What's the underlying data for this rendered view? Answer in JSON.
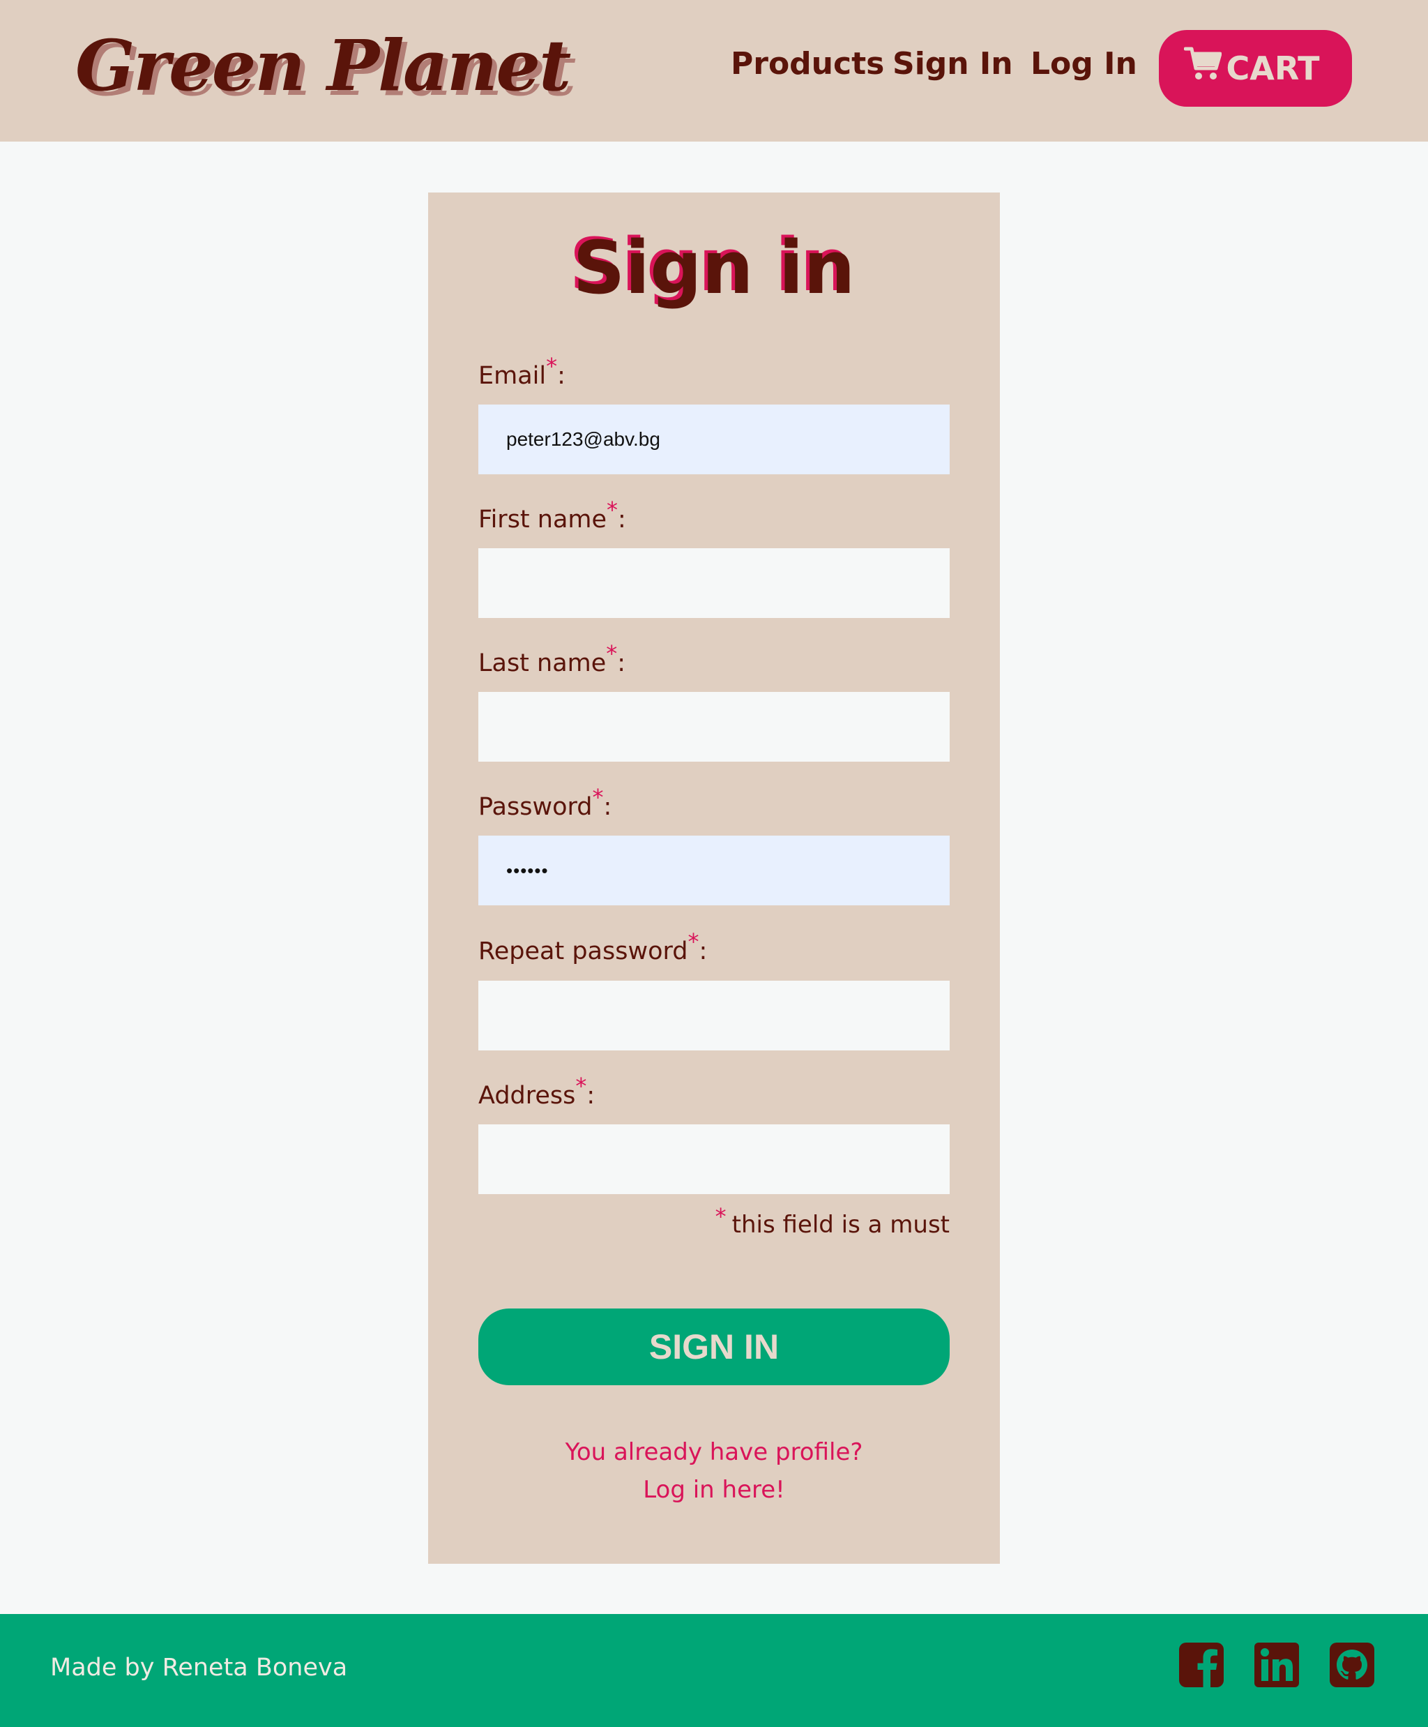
{
  "header": {
    "logo": "Green Planet",
    "nav": {
      "products": "Products",
      "sign_in": "Sign In",
      "log_in": "Log In"
    },
    "cart_label": "CART"
  },
  "form": {
    "title": "Sign in",
    "required_marker": "*",
    "label_suffix": ":",
    "fields": [
      {
        "label": "Email",
        "value": "peter123@abv.bg",
        "type": "email"
      },
      {
        "label": "First name",
        "value": "",
        "type": "text"
      },
      {
        "label": "Last name",
        "value": "",
        "type": "text"
      },
      {
        "label": "Password",
        "value": "••••••",
        "type": "password"
      },
      {
        "label": "Repeat password",
        "value": "",
        "type": "password"
      },
      {
        "label": "Address",
        "value": "",
        "type": "text"
      }
    ],
    "must_note": "this field is a must",
    "submit_label": "SIGN IN",
    "login_prompt_line1": "You already have profile?",
    "login_prompt_line2": "Log in here!"
  },
  "footer": {
    "credit": "Made by Reneta Boneva",
    "social_icons": [
      "facebook-icon",
      "linkedin-icon",
      "github-icon"
    ]
  },
  "colors": {
    "header_bg": "#e0cfc1",
    "text_dark": "#5a140a",
    "accent_pink": "#d91459",
    "brand_green": "#00a676",
    "page_bg": "#f6f8f8",
    "autofill_bg": "#e8f0fe"
  }
}
